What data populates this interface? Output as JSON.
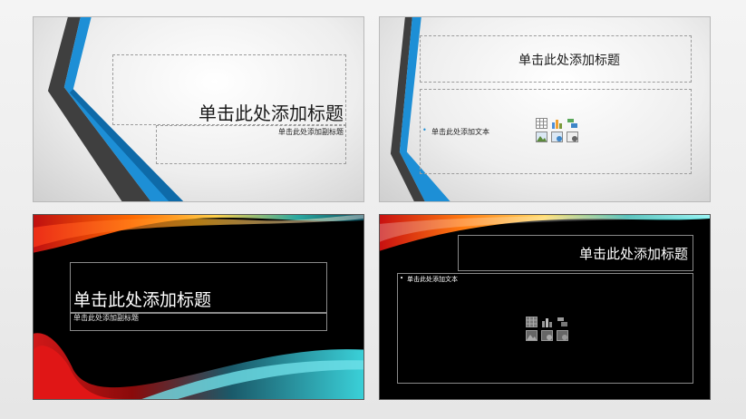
{
  "slides": [
    {
      "title": "单击此处添加标题",
      "subtitle": "单击此处添加副标题"
    },
    {
      "title": "单击此处添加标题",
      "bullet": "单击此处添加文本"
    },
    {
      "title": "单击此处添加标题",
      "subtitle": "单击此处添加副标题"
    },
    {
      "title": "单击此处添加标题",
      "bullet": "单击此处添加文本"
    }
  ],
  "content_icons": [
    "table-icon",
    "chart-icon",
    "smartart-icon",
    "picture-icon",
    "online-picture-icon",
    "video-icon"
  ],
  "colors": {
    "accent_blue": "#1e90d8",
    "accent_dark": "#3d3d3d",
    "light_bg": "#eeeeee",
    "dark_bg": "#000000"
  }
}
